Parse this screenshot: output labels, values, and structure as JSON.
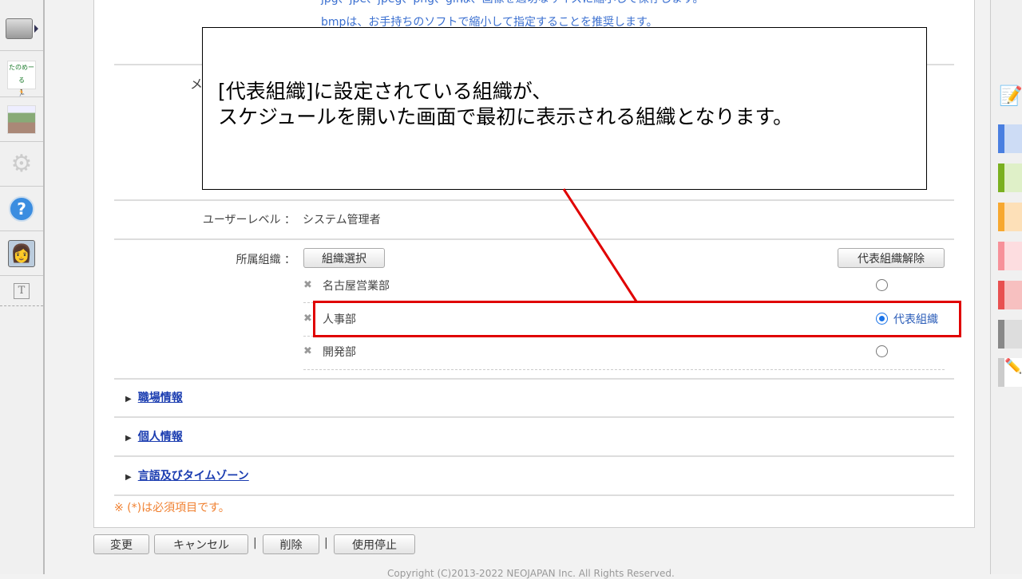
{
  "page": {
    "top_notes": [
      "jpg、jpe、jpeg、png、gifは、画像を適切なサイズに縮小して保存します。",
      "bmpは、お手持ちのソフトで縮小して指定することを推奨します。"
    ],
    "hidden_label": "メ",
    "user_level": {
      "label": "ユーザーレベル ：",
      "value": "システム管理者"
    },
    "org": {
      "label": "所属組織 ：",
      "select_button": "組織選択",
      "release_button": "代表組織解除",
      "items": [
        {
          "name": "名古屋営業部",
          "primary": false
        },
        {
          "name": "人事部",
          "primary": true
        },
        {
          "name": "開発部",
          "primary": false
        }
      ],
      "primary_label": "代表組織"
    },
    "sections": [
      "職場情報",
      "個人情報",
      "言語及びタイムゾーン"
    ],
    "required_note": "※ (*)は必須項目です。",
    "actions": {
      "change": "変更",
      "cancel": "キャンセル",
      "delete": "削除",
      "suspend": "使用停止",
      "separator": "|"
    },
    "copyright": "Copyright (C)2013-2022 NEOJAPAN Inc. All Rights Reserved."
  },
  "callout": {
    "line1": "[代表組織]に設定されている組織が、",
    "line2": "スケジュールを開いた画面で最初に表示される組織となります。"
  },
  "sidebar_icons": [
    "folder-icon",
    "tanomail-icon",
    "banner-icon",
    "gear-icon",
    "help-icon",
    "support-icon",
    "text-icon"
  ],
  "right_tabs": [
    {
      "dark": "#4a7fe0",
      "light": "#cddcf5"
    },
    {
      "dark": "#7ab020",
      "light": "#dff0c8"
    },
    {
      "dark": "#f7a830",
      "light": "#fde0b8"
    },
    {
      "dark": "#f7919a",
      "light": "#fddde0"
    },
    {
      "dark": "#e85050",
      "light": "#f7c0c0"
    },
    {
      "dark": "#888888",
      "light": "#dddddd"
    }
  ],
  "colors": {
    "accent": "#1a73e8",
    "highlight": "#e00000",
    "note": "#f08030"
  }
}
